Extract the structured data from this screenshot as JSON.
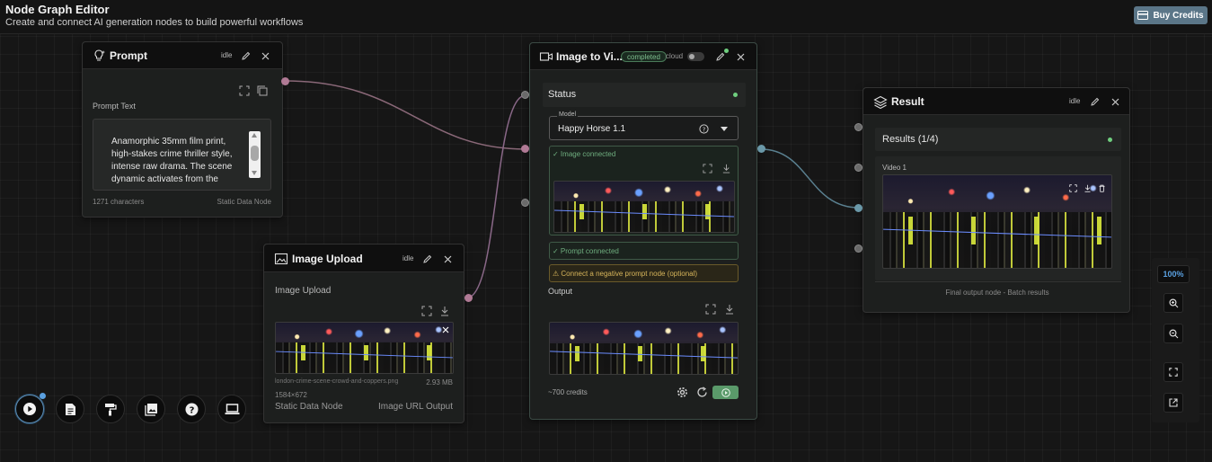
{
  "header": {
    "title": "Node Graph Editor",
    "subtitle": "Create and connect AI generation nodes to build powerful workflows",
    "buy_credits": "Buy Credits"
  },
  "prompt_node": {
    "title": "Prompt",
    "status": "idle",
    "section_label": "Prompt Text",
    "text": "Anamorphic 35mm film print, high-stakes crime thriller style, intense raw drama. The scene dynamic activates from the",
    "char_count": "1271 characters",
    "node_type": "Static Data Node"
  },
  "upload_node": {
    "title": "Image Upload",
    "status": "idle",
    "section_label": "Image Upload",
    "filename": "london-crime-scene-crowd-and-coppers.png",
    "filesize": "2.93 MB",
    "dimensions": "1584×672",
    "node_type": "Static Data Node",
    "output_type": "Image URL Output"
  },
  "video_node": {
    "title": "Image to Vi...",
    "badge": "completed",
    "cloud_label": "cloud",
    "status_label": "Status",
    "model_label": "Model",
    "model_value": "Happy Horse 1.1",
    "image_connected": "✓ Image connected",
    "prompt_connected": "✓ Prompt connected",
    "negative_prompt": "⚠ Connect a negative prompt node (optional)",
    "output_label": "Output",
    "credits": "~700 credits"
  },
  "result_node": {
    "title": "Result",
    "status": "idle",
    "results_label": "Results (1/4)",
    "video_label": "Video 1",
    "footer": "Final output node - Batch results"
  },
  "zoom": {
    "level": "100%"
  },
  "colors": {
    "accent": "#5b7688",
    "success": "#5a9a6a",
    "warning": "#c8a040",
    "badge": "#7fbf8f"
  },
  "icons": {
    "dock": [
      "play-icon",
      "document-icon",
      "paint-roller-icon",
      "gallery-icon",
      "help-icon",
      "laptop-icon"
    ],
    "zoom": [
      "zoom-in-icon",
      "zoom-out-icon",
      "fit-view-icon",
      "export-icon"
    ]
  }
}
